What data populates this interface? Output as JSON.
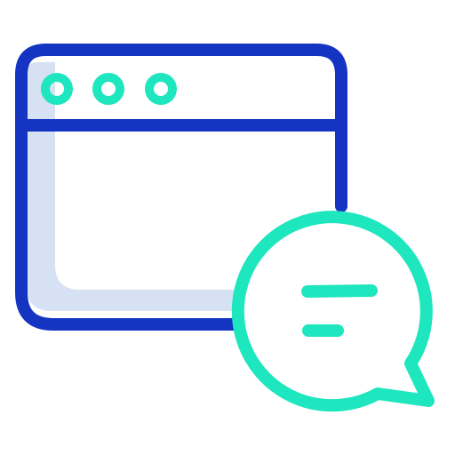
{
  "icon": {
    "name": "browser-window-chat-icon",
    "parts": [
      "browser-window-icon",
      "window-dot-icon",
      "chat-bubble-icon",
      "message-line-icon"
    ]
  },
  "colors": {
    "window_stroke": "#1534C2",
    "window_shade": "#D6E1F3",
    "accent": "#1EE6BE",
    "background": "#FFFFFF"
  }
}
